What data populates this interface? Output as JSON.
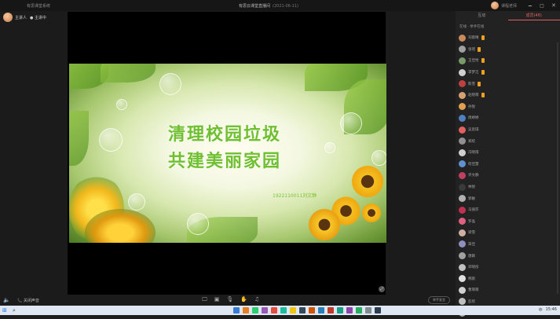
{
  "window": {
    "left_title": "有思课堂系统",
    "title": "有思云课堂直播间",
    "subtitle": "(2021-06-11)",
    "user_name": "课程老师",
    "controls": [
      "🗕",
      "◻",
      "✕"
    ]
  },
  "host": {
    "name": "主讲人",
    "role_label": "主讲中"
  },
  "slide": {
    "title_line1": "清理校园垃圾",
    "title_line2": "共建美丽家园",
    "author": "1922110011刘文静"
  },
  "sidebar": {
    "tabs": [
      {
        "label": "互动",
        "active": false
      },
      {
        "label": "成员(46)",
        "active": true
      }
    ],
    "list_header": "在线 · 举手在线",
    "participants": [
      {
        "name": "刘雨晴",
        "badge": true,
        "color": "#c98a5a"
      },
      {
        "name": "张瑶",
        "badge": true,
        "color": "#a0a0a0"
      },
      {
        "name": "王佳怡",
        "badge": true,
        "color": "#7a9a6a"
      },
      {
        "name": "李梦洁",
        "badge": true,
        "color": "#d0d0d0"
      },
      {
        "name": "陈雪",
        "badge": true,
        "color": "#c04040"
      },
      {
        "name": "赵晓萌",
        "badge": true,
        "color": "#d6a070"
      },
      {
        "name": "孙悦",
        "badge": false,
        "color": "#e0a050"
      },
      {
        "name": "周婷婷",
        "badge": false,
        "color": "#5080c0"
      },
      {
        "name": "吴思琪",
        "badge": false,
        "color": "#e06060"
      },
      {
        "name": "郑欣",
        "badge": false,
        "color": "#909090"
      },
      {
        "name": "冯晓雨",
        "badge": false,
        "color": "#d0d0d0"
      },
      {
        "name": "何佳慧",
        "badge": false,
        "color": "#6090d0"
      },
      {
        "name": "许文静",
        "badge": false,
        "color": "#c04060"
      },
      {
        "name": "林悦",
        "badge": false,
        "color": "#3a3a3a"
      },
      {
        "name": "郭敏",
        "badge": false,
        "color": "#b0b0b0"
      },
      {
        "name": "马丽莎",
        "badge": false,
        "color": "#c03050"
      },
      {
        "name": "罗晶",
        "badge": false,
        "color": "#e06080"
      },
      {
        "name": "梁雪",
        "badge": false,
        "color": "#d0b0a0"
      },
      {
        "name": "宋佳",
        "badge": false,
        "color": "#9090c0"
      },
      {
        "name": "唐颖",
        "badge": false,
        "color": "#a0a0a0"
      },
      {
        "name": "邓晓彤",
        "badge": false,
        "color": "#c0c0c0"
      },
      {
        "name": "韩雨",
        "badge": false,
        "color": "#e0e0e0"
      },
      {
        "name": "曹萌萌",
        "badge": false,
        "color": "#d0d0d0"
      },
      {
        "name": "彭欣",
        "badge": false,
        "color": "#c0c0c0"
      },
      {
        "name": "曾瑶",
        "badge": false,
        "color": "#b0b0b0"
      }
    ]
  },
  "bottombar": {
    "mic_label": "关闭声音",
    "tools": [
      "🖵",
      "▣",
      "🎙",
      "✋",
      "♫"
    ],
    "right_button": "举手发言"
  },
  "taskbar": {
    "start": "⊞",
    "search": "⌕",
    "apps": [
      "#3a7bd5",
      "#e67e22",
      "#2ecc71",
      "#9b59b6",
      "#e74c3c",
      "#1abc9c",
      "#f1c40f",
      "#34495e",
      "#d35400",
      "#2980b9",
      "#c0392b",
      "#16a085",
      "#8e44ad",
      "#27ae60",
      "#7f8c8d",
      "#2c3e50"
    ],
    "time": "15:46",
    "lang": "中"
  }
}
